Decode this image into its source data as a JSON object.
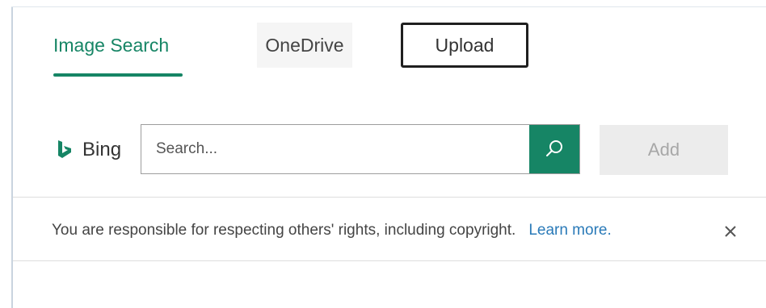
{
  "tabs": {
    "items": [
      {
        "label": "Image Search",
        "state": "active"
      },
      {
        "label": "OneDrive",
        "state": "inactive"
      },
      {
        "label": "Upload",
        "state": "highlighted"
      }
    ]
  },
  "search": {
    "brand": "Bing",
    "placeholder": "Search...",
    "value": "",
    "search_icon": "search-icon",
    "add_label": "Add",
    "add_enabled": false
  },
  "notice": {
    "text": "You are responsible for respecting others' rights, including copyright.",
    "link": "Learn more.",
    "close_icon": "close-icon"
  },
  "colors": {
    "accent": "#168565",
    "link": "#2a7ab8",
    "disabled_bg": "#ececec",
    "disabled_text": "#a7a7a7"
  }
}
